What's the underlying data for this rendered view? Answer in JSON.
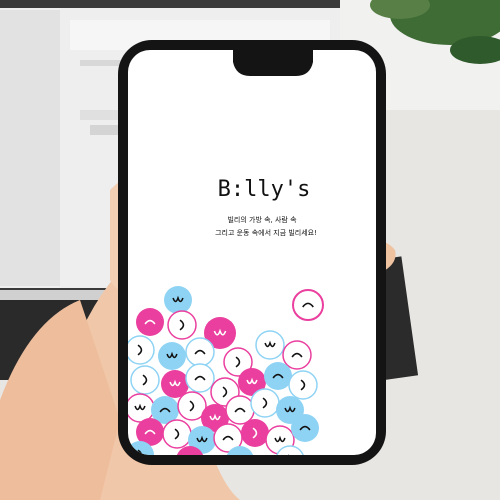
{
  "app": {
    "brand_name": "B:lly's",
    "tagline_line1": "빌리의 가방 속, 사람 속",
    "tagline_line2": "그리고 운동 속에서 지금 빌리세요!"
  },
  "palette": {
    "pink": "#ea3f9e",
    "sky_blue": "#8fd3f4",
    "screen_white": "#ffffff",
    "phone_black": "#141414",
    "skin": "#f0c7a8"
  }
}
